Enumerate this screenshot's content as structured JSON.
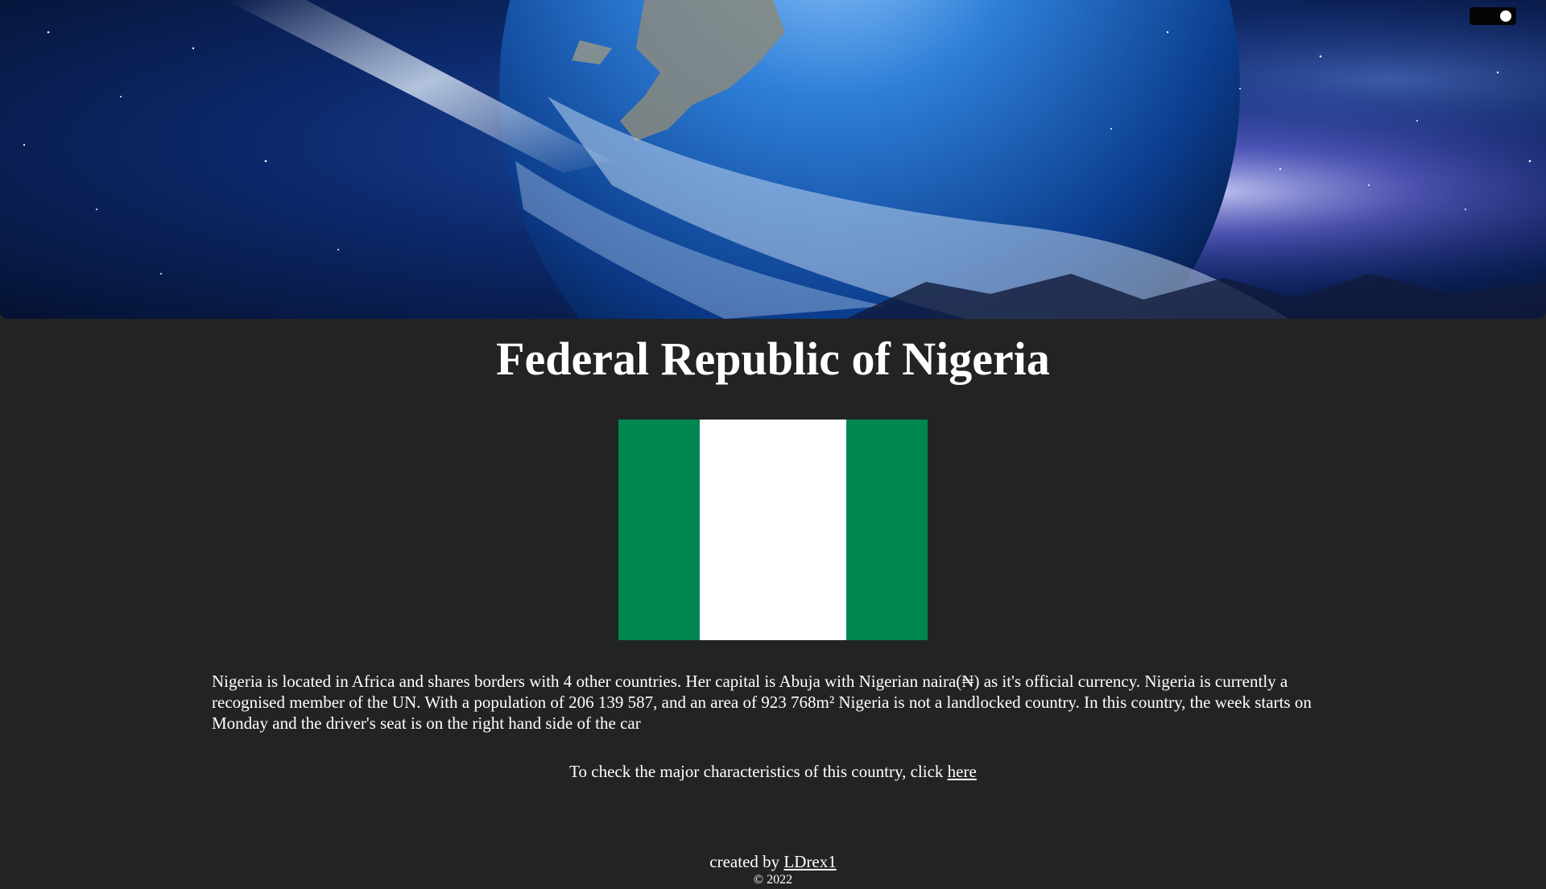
{
  "header": {
    "theme_toggle": {
      "state": "on"
    }
  },
  "main": {
    "title": "Federal Republic of Nigeria",
    "flag": {
      "colors": [
        "#008751",
        "#ffffff",
        "#008751"
      ]
    },
    "description": "Nigeria is located in Africa and shares borders with 4 other countries. Her capital is Abuja with Nigerian naira(₦) as it's official currency. Nigeria is currently a recognised member of the UN. With a population of 206 139 587, and an area of 923 768m² Nigeria is not a landlocked country. In this country, the week starts on Monday and the driver's seat is on the right hand side of the car",
    "characteristics_text": "To check the major characteristics of this country, click ",
    "characteristics_link": "here"
  },
  "footer": {
    "created_by_text": "created by ",
    "author_link": "LDrex1",
    "copyright": "© 2022"
  },
  "colors": {
    "background": "#222424",
    "text": "#ffffff",
    "flag_green": "#008751"
  }
}
